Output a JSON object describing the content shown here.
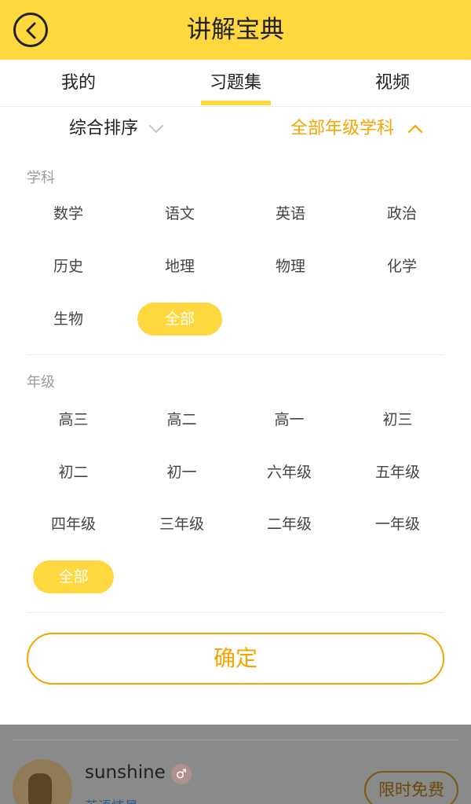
{
  "header": {
    "title": "讲解宝典",
    "back_icon": "chevron-left-icon"
  },
  "tabs": [
    {
      "label": "我的"
    },
    {
      "label": "习题集",
      "active": true
    },
    {
      "label": "视频"
    }
  ],
  "sort_bar": {
    "sort_label": "综合排序",
    "filter_label": "全部年级学科"
  },
  "filter": {
    "subject_label": "学科",
    "subjects": [
      "数学",
      "语文",
      "英语",
      "政治",
      "历史",
      "地理",
      "物理",
      "化学",
      "生物",
      "全部"
    ],
    "subject_selected": "全部",
    "grade_label": "年级",
    "grades": [
      "高三",
      "高二",
      "高一",
      "初三",
      "初二",
      "初一",
      "六年级",
      "五年级",
      "四年级",
      "三年级",
      "二年级",
      "一年级",
      "全部"
    ],
    "grade_selected": "全部",
    "confirm_label": "确定"
  },
  "background_item": {
    "username": "sunshine",
    "gender_icon": "male-icon",
    "subtitle": "英语情景",
    "free_label": "限时免费"
  },
  "colors": {
    "accent_yellow": "#FFD83F",
    "accent_orange": "#F5A500"
  }
}
